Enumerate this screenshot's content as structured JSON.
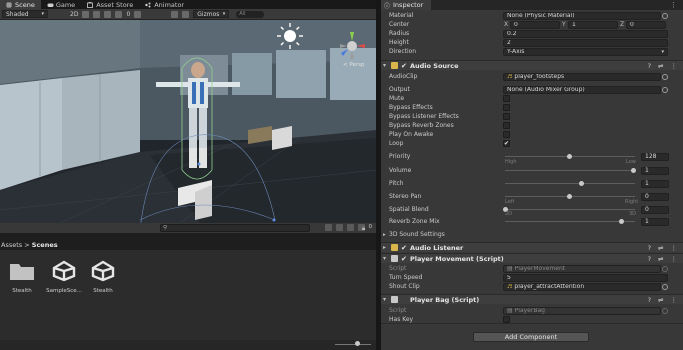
{
  "tabs": [
    {
      "label": "Scene",
      "icon": "hash-icon",
      "active": true
    },
    {
      "label": "Game",
      "icon": "gamepad-icon",
      "active": false
    },
    {
      "label": "Asset Store",
      "icon": "store-icon",
      "active": false
    },
    {
      "label": "Animator",
      "icon": "animator-icon",
      "active": false
    }
  ],
  "scene_toolbar": {
    "shading_mode": "Shaded",
    "mode_2d": "2D",
    "layer_count": "0",
    "gizmos_label": "Gizmos",
    "search_prefix": "All"
  },
  "scene": {
    "persp_label": "< Persp"
  },
  "project": {
    "breadcrumb_root": "Assets",
    "breadcrumb_sep": ">",
    "breadcrumb_current": "Scenes",
    "hidden_count": "0",
    "items": [
      {
        "name": "Stealth",
        "icon": "folder-icon"
      },
      {
        "name": "SampleSce...",
        "icon": "unity-scene-icon"
      },
      {
        "name": "Stealth",
        "icon": "unity-scene-icon"
      }
    ]
  },
  "inspector": {
    "tab_label": "Inspector",
    "collider": {
      "material_label": "Material",
      "material_value": "None (Physic Material)",
      "center_label": "Center",
      "center_x_label": "X",
      "center_x": "0",
      "center_y_label": "Y",
      "center_y": "1",
      "center_z_label": "Z",
      "center_z": "0",
      "radius_label": "Radius",
      "radius_value": "0.2",
      "height_label": "Height",
      "height_value": "2",
      "direction_label": "Direction",
      "direction_value": "Y-Axis"
    },
    "audio_source": {
      "title": "Audio Source",
      "audioclip_label": "AudioClip",
      "audioclip_value": "player_footsteps",
      "output_label": "Output",
      "output_value": "None (Audio Mixer Group)",
      "mute_label": "Mute",
      "bypass_effects_label": "Bypass Effects",
      "bypass_listener_label": "Bypass Listener Effects",
      "bypass_reverb_label": "Bypass Reverb Zones",
      "play_on_awake_label": "Play On Awake",
      "loop_label": "Loop",
      "loop_checked": true,
      "priority_label": "Priority",
      "priority_value": "128",
      "priority_fraction": 0.5,
      "priority_low_label": "High",
      "priority_high_label": "Low",
      "volume_label": "Volume",
      "volume_value": "1",
      "volume_fraction": 1.0,
      "pitch_label": "Pitch",
      "pitch_value": "1",
      "pitch_fraction": 0.6,
      "stereo_pan_label": "Stereo Pan",
      "stereo_pan_value": "0",
      "stereo_pan_fraction": 0.5,
      "stereo_left_label": "Left",
      "stereo_right_label": "Right",
      "spatial_blend_label": "Spatial Blend",
      "spatial_blend_value": "0",
      "spatial_blend_fraction": 0.0,
      "spatial_2d_label": "2D",
      "spatial_3d_label": "3D",
      "reverb_mix_label": "Reverb Zone Mix",
      "reverb_mix_value": "1",
      "reverb_mix_fraction": 0.91,
      "sound_settings_label": "3D Sound Settings"
    },
    "audio_listener": {
      "title": "Audio Listener"
    },
    "player_movement": {
      "title": "Player Movement (Script)",
      "script_label": "Script",
      "script_value": "PlayerMovement",
      "turn_speed_label": "Turn Speed",
      "turn_speed_value": "5",
      "shout_clip_label": "Shout Clip",
      "shout_clip_value": "player_attractAttention"
    },
    "player_bag": {
      "title": "Player Bag (Script)",
      "script_label": "Script",
      "script_value": "PlayerBag",
      "has_key_label": "Has Key"
    },
    "add_component_label": "Add Component"
  },
  "colors": {
    "panel_bg": "#383838",
    "accent_selected": "#3c3c3c",
    "sun_yellow": "#ffffff",
    "collider_green": "#8fd18f"
  }
}
